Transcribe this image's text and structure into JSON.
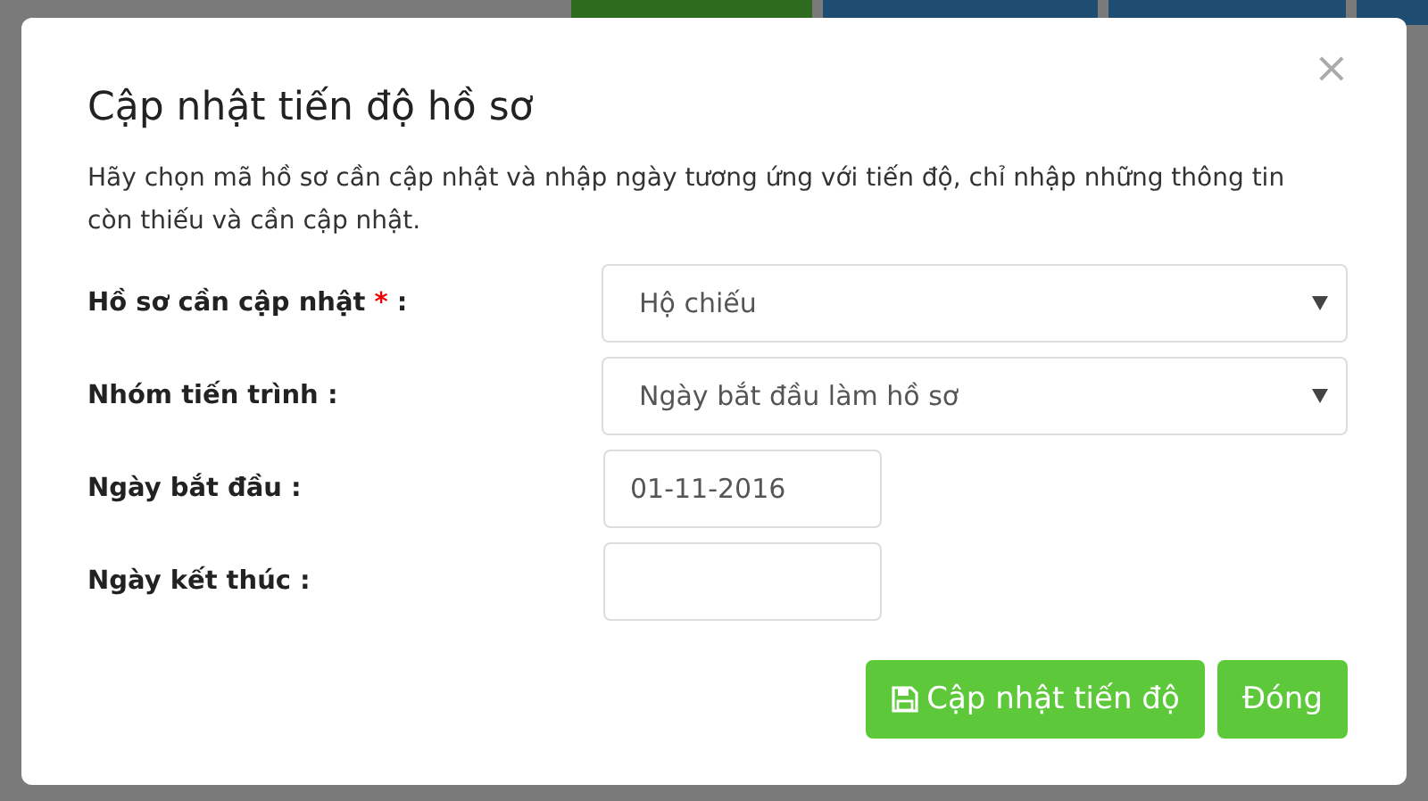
{
  "dialog": {
    "title": "Cập nhật tiến độ hồ sơ",
    "close": "×",
    "description": "Hãy chọn mã hồ sơ cần cập nhật và nhập ngày tương ứng với tiến độ, chỉ nhập những thông tin còn thiếu và cần cập nhật.",
    "fields": [
      {
        "kind": "select",
        "label": "Hồ sơ cần cập nhật",
        "required_mark": "*",
        "separator": ":",
        "value": "Hộ chiếu"
      },
      {
        "kind": "select",
        "label": "Nhóm tiến trình",
        "separator": ":",
        "value": "Ngày bắt đầu làm hồ sơ"
      },
      {
        "kind": "date",
        "label": "Ngày bắt đầu",
        "separator": ":",
        "value": "01-11-2016"
      },
      {
        "kind": "date",
        "label": "Ngày kết thúc",
        "separator": ":"
      }
    ],
    "buttons": [
      {
        "kind": "save",
        "label": "Cập nhật tiến độ"
      },
      {
        "kind": "close",
        "label": "Đóng"
      }
    ]
  }
}
